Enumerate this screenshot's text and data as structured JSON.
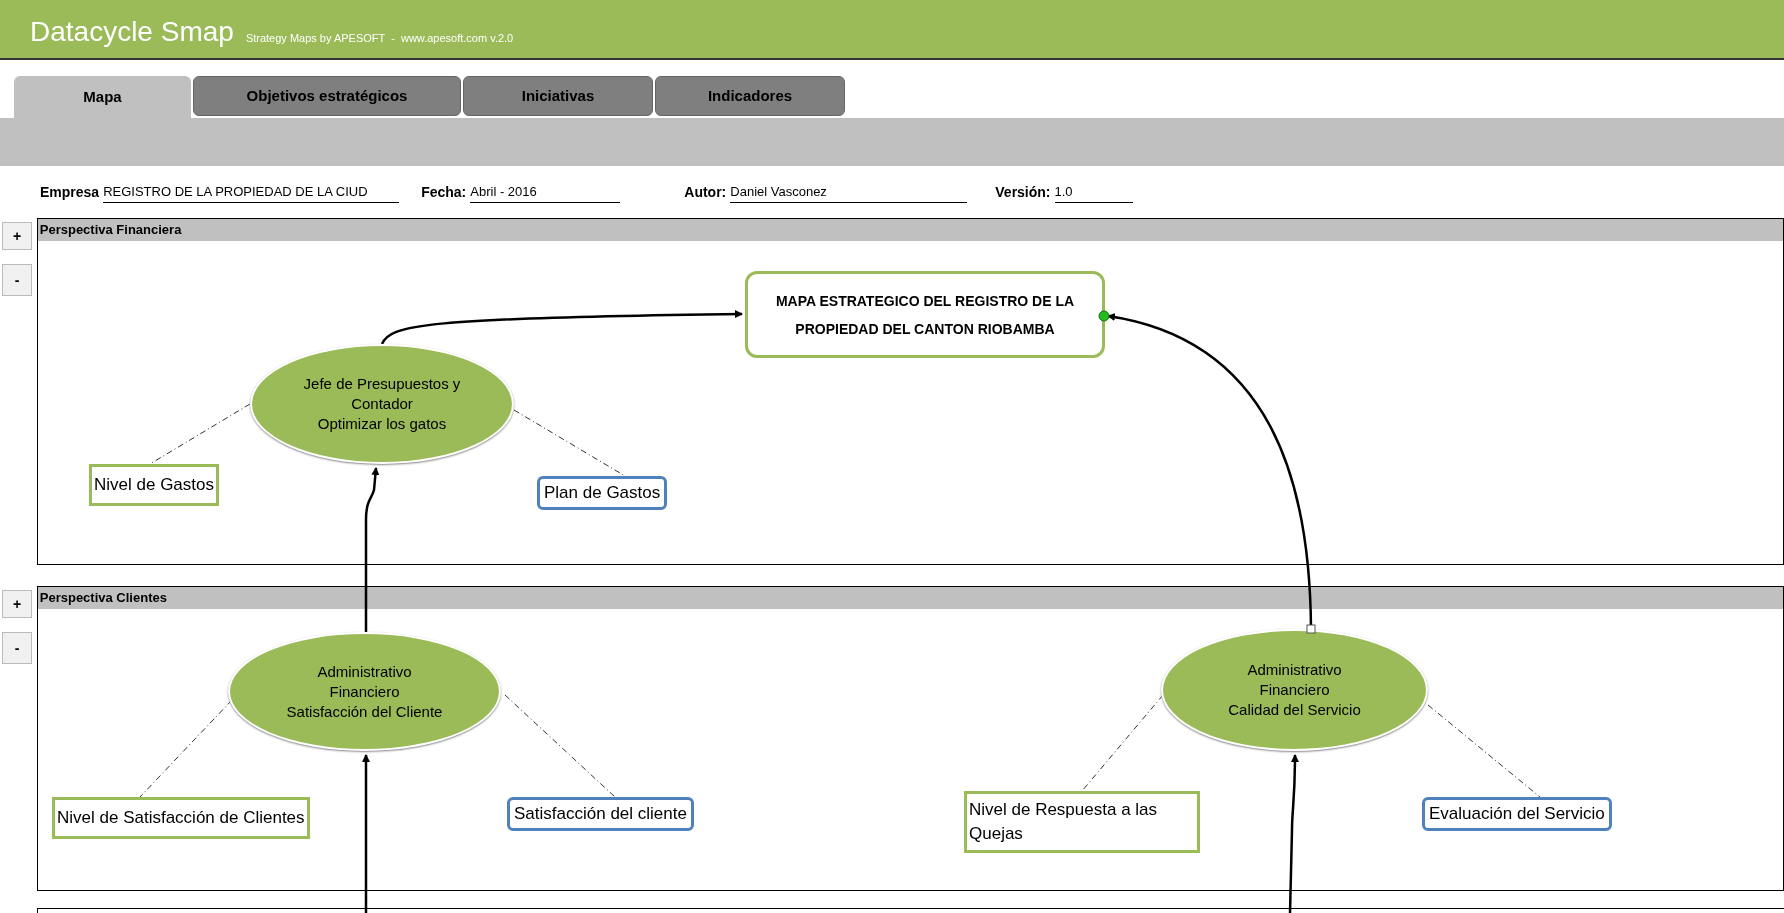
{
  "app": {
    "title": "Datacycle Smap",
    "subtitle": "Strategy Maps by APESOFT  -  www.apesoft.com v.2.0"
  },
  "tabs": [
    {
      "label": "Mapa",
      "selected": true
    },
    {
      "label": "Objetivos estratégicos",
      "selected": false
    },
    {
      "label": "Iniciativas",
      "selected": false
    },
    {
      "label": "Indicadores",
      "selected": false
    }
  ],
  "info": [
    {
      "label": "Empresa",
      "value": "REGISTRO DE LA PROPIEDAD DE LA CIUD"
    },
    {
      "label": "Fecha:",
      "value": "Abril - 2016"
    },
    {
      "label": "Autor:",
      "value": "Daniel Vasconez"
    },
    {
      "label": "Versión:",
      "value": "1.0"
    }
  ],
  "map_title": "MAPA ESTRATEGICO DEL REGISTRO DE LA PROPIEDAD DEL CANTON RIOBAMBA",
  "perspectives": [
    {
      "title": "Perspectiva Financiera",
      "expand_button": "+",
      "collapse_button": "-",
      "objectives": [
        {
          "lines": [
            "Jefe de Presupuestos y",
            "Contador",
            "Optimizar los gatos"
          ],
          "indicator": "Nivel de Gastos",
          "initiative": "Plan de Gastos"
        }
      ]
    },
    {
      "title": "Perspectiva Clientes",
      "expand_button": "+",
      "collapse_button": "-",
      "objectives": [
        {
          "lines": [
            "Administrativo",
            "Financiero",
            "Satisfacción del Cliente"
          ],
          "indicator": "Nivel de Satisfacción de Clientes",
          "initiative": "Satisfacción del cliente"
        },
        {
          "lines": [
            "Administrativo",
            "Financiero",
            "Calidad del Servicio"
          ],
          "indicator": "Nivel de Respuesta a las Quejas",
          "initiative": "Evaluación del Servicio"
        }
      ]
    }
  ]
}
